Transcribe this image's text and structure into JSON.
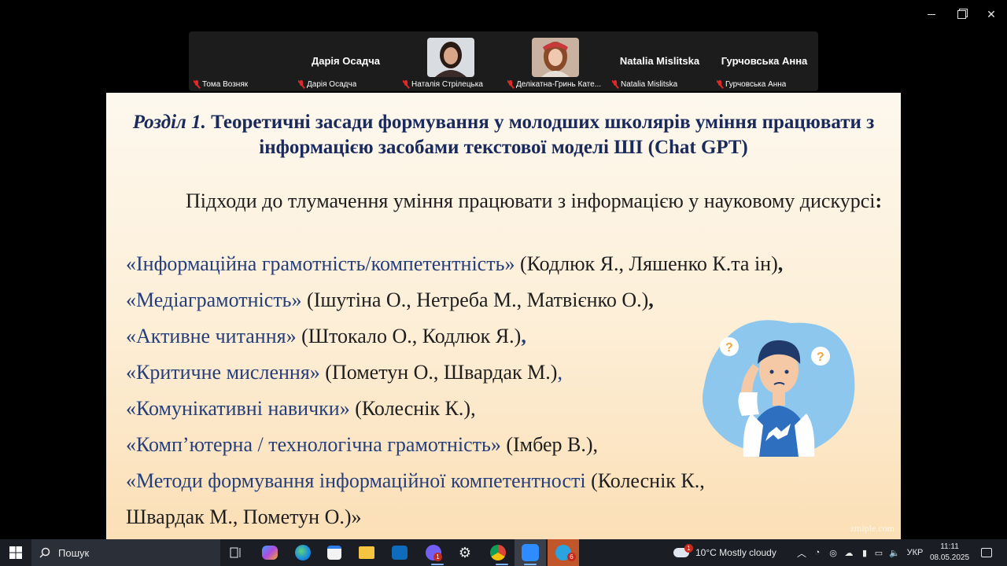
{
  "participants": [
    {
      "big_name": "",
      "caption": "Тома Возняк"
    },
    {
      "big_name": "Дарія Осадча",
      "caption": "Дарія Осадча"
    },
    {
      "big_name": "",
      "caption": "Наталія Стрілецька"
    },
    {
      "big_name": "",
      "caption": "Делікатна-Гринь Кате..."
    },
    {
      "big_name": "Natalia Mislitska",
      "caption": "Natalia Mislitska"
    },
    {
      "big_name": "Гурчовська Анна",
      "caption": "Гурчовська Анна"
    }
  ],
  "slide": {
    "title_italic": "Розділ 1.",
    "title_rest": " Теоретичні засади формування у молодших школярів уміння працювати з інформацією засобами текстової моделі ШІ (Chat GPT)",
    "intro_text": "Підходи до тлумачення уміння працювати з інформацією у науковому дискурсі",
    "intro_colon": ":",
    "items": [
      {
        "term": "«Інформаційна грамотність/компетентність»",
        "authors": " (Кодлюк Я., Ляшенко К.та ін)",
        "end": ","
      },
      {
        "term": "«Медіаграмотність»",
        "authors": " (Ішутіна О., Нетреба М., Матвієнко О.)",
        "end": ","
      },
      {
        "term": "«Активне читання»",
        "authors": " (Штокало О., Кодлюк Я.)",
        "end": ","
      },
      {
        "term": "«Критичне мислення»",
        "authors": " (Пометун О., Швардак М.)",
        "end": ","
      },
      {
        "term": "«Комунікативні навички»",
        "authors": " (Колеснік К.)",
        "end": ","
      },
      {
        "term": "«Комп’ютерна / технологічна грамотність»",
        "authors": " (Імбер В.)",
        "end": ","
      },
      {
        "term": " «Методи формування інформаційної компетентності",
        "authors": " (Колеснік К.",
        "end": ","
      }
    ],
    "last_line": "Швардак М., Пометун О.)»",
    "watermark": "zmiple.com"
  },
  "taskbar": {
    "search_label": "Пошук",
    "viber_badge": "1",
    "telegram_badge": "6",
    "weather_badge": "1",
    "weather": "10°C  Mostly cloudy",
    "language": "УКР",
    "time": "11:11",
    "date": "08.05.2025"
  },
  "colors": {
    "title": "#1b2a5c",
    "term": "#263f7a",
    "taskbar": "#1a1d24"
  }
}
